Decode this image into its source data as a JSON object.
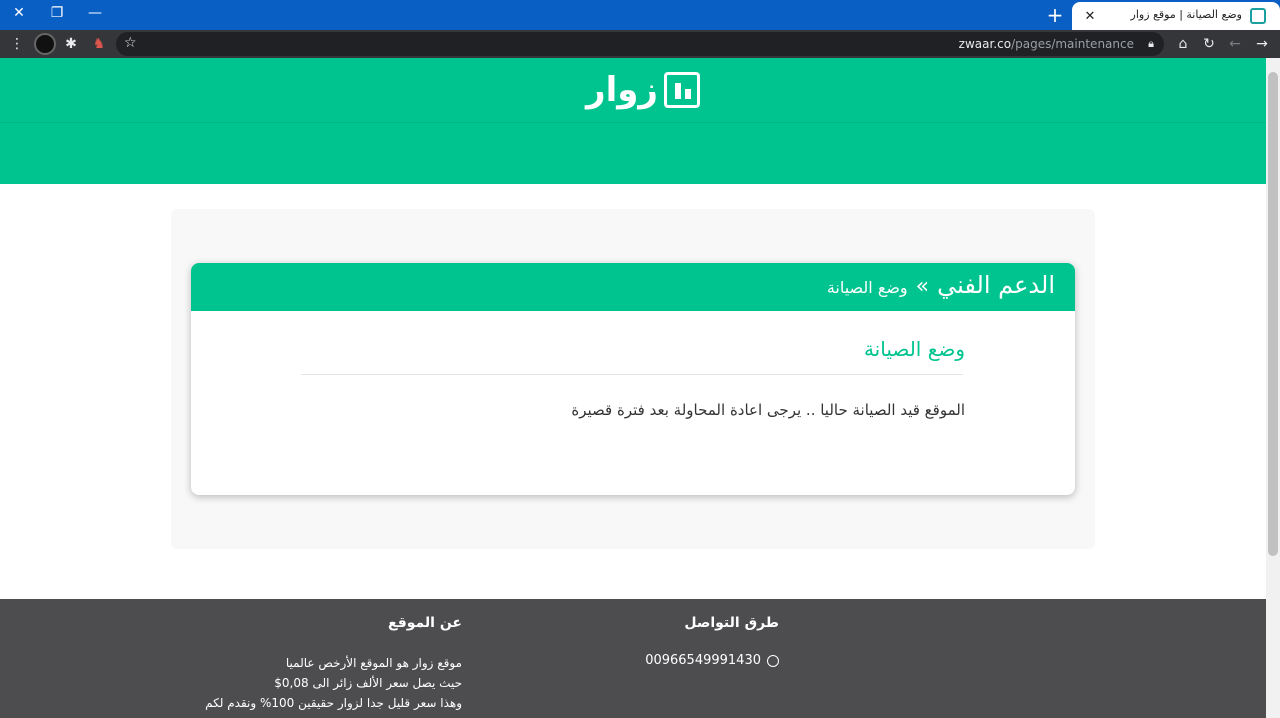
{
  "browser": {
    "tab_title": "وضع الصيانة | موقع زوار",
    "tab_close": "✕",
    "new_tab": "+",
    "window": {
      "close": "✕",
      "restore": "❐",
      "minimize": "—"
    },
    "url_host": "zwaar.co",
    "url_path": "/pages/maintenance"
  },
  "site": {
    "logo_text": "زوار"
  },
  "card": {
    "breadcrumb_root": "الدعم الفني",
    "breadcrumb_sep": "»",
    "breadcrumb_current": "وضع الصيانة",
    "title": "وضع الصيانة",
    "message": "الموقع قيد الصيانة حاليا .. يرجى اعادة المحاولة بعد فترة قصيرة"
  },
  "footer": {
    "about_title": "عن الموقع",
    "about_lines": [
      "موقع زوار هو الموقع الأرخص عالميا",
      "حيث يصل سعر الألف زائر الى 0,08$",
      "وهذا سعر قليل جدا لزوار حقيقين 100% ونقدم لكم"
    ],
    "contact_title": "طرق التواصل",
    "phone": "00966549991430"
  }
}
